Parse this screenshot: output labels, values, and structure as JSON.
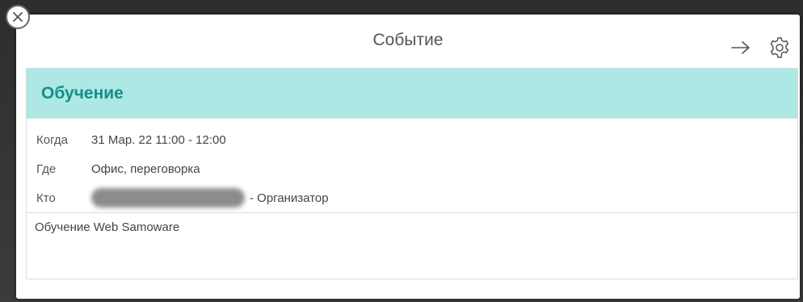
{
  "dialog": {
    "title": "Событие",
    "icons": {
      "close": "close-icon",
      "forward": "arrow-right-icon",
      "settings": "gear-icon"
    }
  },
  "event": {
    "name": "Обучение",
    "accent_color": "#148f87",
    "header_bg": "#ade8e5",
    "when_label": "Когда",
    "when_value": "31 Мар. 22 11:00 - 12:00",
    "where_label": "Где",
    "where_value": "Офис, переговорка",
    "who_label": "Кто",
    "who_role": "- Организатор",
    "description": "Обучение Web Samoware"
  }
}
